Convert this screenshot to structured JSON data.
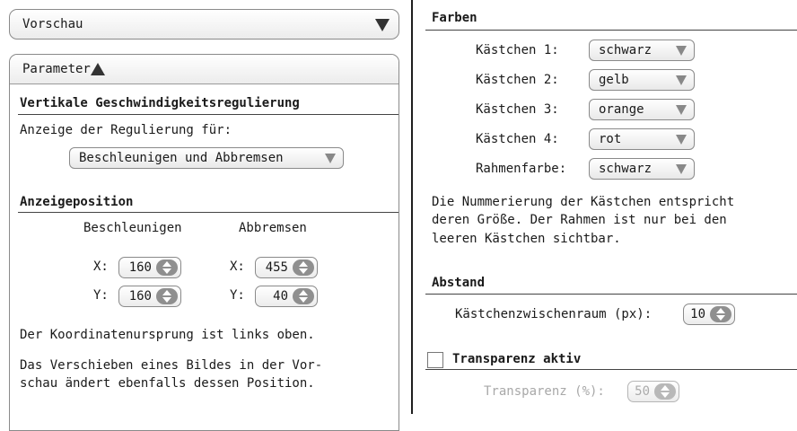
{
  "preview_panel": {
    "title": "Vorschau"
  },
  "parameter_panel": {
    "title": "Parameter",
    "vertical_section": {
      "title": "Vertikale Geschwindigkeitsregulierung",
      "display_label": "Anzeige der Regulierung für:",
      "display_selected": "Beschleunigen und Abbremsen"
    },
    "position_section": {
      "title": "Anzeigeposition",
      "col_accel": "Beschleunigen",
      "col_brake": "Abbremsen",
      "x_label": "X:",
      "y_label": "Y:",
      "accel_x": "160",
      "accel_y": "160",
      "brake_x": "455",
      "brake_y": "40",
      "note1": "Der Koordinatenursprung ist links oben.",
      "note2_line1": "Das Verschieben eines Bildes in der Vor-",
      "note2_line2": "schau ändert ebenfalls dessen Position."
    }
  },
  "colors_section": {
    "title": "Farben",
    "rows": [
      {
        "label": "Kästchen 1:",
        "value": "schwarz"
      },
      {
        "label": "Kästchen 2:",
        "value": "gelb"
      },
      {
        "label": "Kästchen 3:",
        "value": "orange"
      },
      {
        "label": "Kästchen 4:",
        "value": "rot"
      },
      {
        "label": "Rahmenfarbe:",
        "value": "schwarz"
      }
    ],
    "note_line1": "Die Nummerierung der Kästchen entspricht",
    "note_line2": "deren Größe. Der Rahmen ist nur bei den",
    "note_line3": "leeren Kästchen sichtbar."
  },
  "spacing_section": {
    "title": "Abstand",
    "label": "Kästchenzwischenraum (px):",
    "value": "10"
  },
  "transparency_section": {
    "checkbox_label": "Transparenz aktiv",
    "checked": false,
    "label": "Transparenz (%):",
    "value": "50"
  }
}
